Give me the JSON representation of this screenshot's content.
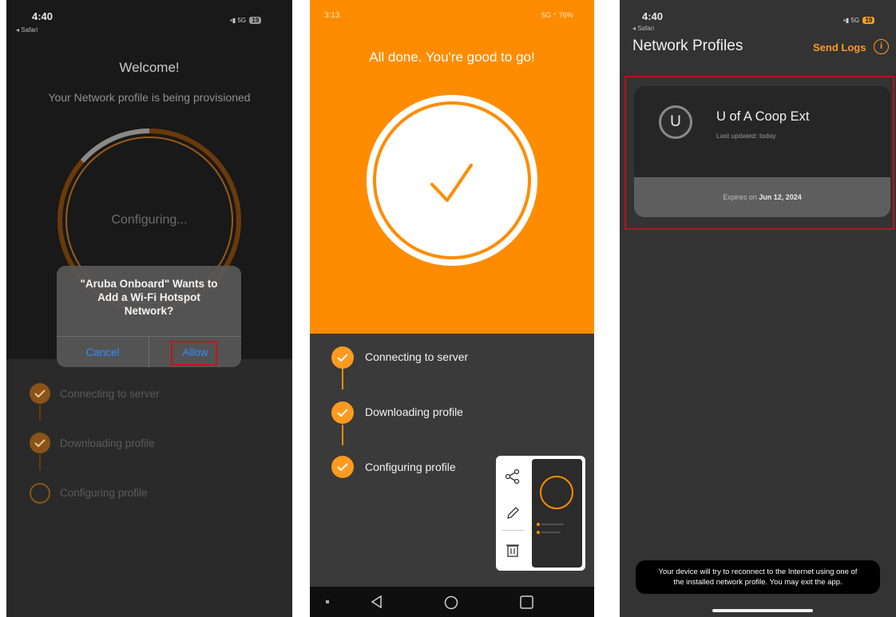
{
  "colors": {
    "accent_orange": "#ff8c00",
    "brand_orange_text": "#ff9a1f",
    "highlight_red": "#c4161c",
    "ios_blue": "#2f8cff"
  },
  "panel1": {
    "status": {
      "time": "4:40",
      "back_app": "◂ Safari",
      "network": "5G",
      "battery": "19"
    },
    "title": "Welcome!",
    "subtitle": "Your Network profile is being provisioned",
    "progress_label": "Configuring...",
    "dialog": {
      "line1": "\"Aruba Onboard\" Wants to",
      "line2": "Add a Wi-Fi Hotspot",
      "line3": "Network?",
      "cancel": "Cancel",
      "allow": "Allow"
    },
    "steps": [
      {
        "label": "Connecting to server",
        "done": true
      },
      {
        "label": "Downloading profile",
        "done": true
      },
      {
        "label": "Configuring profile",
        "done": false
      }
    ]
  },
  "panel2": {
    "status": {
      "time": "3:13",
      "right": "5G ⁺ 76%"
    },
    "title": "All done. You're good to go!",
    "steps": [
      {
        "label": "Connecting to server"
      },
      {
        "label": "Downloading profile"
      },
      {
        "label": "Configuring profile"
      }
    ],
    "popup_icons": [
      "share-icon",
      "edit-icon",
      "trash-icon"
    ]
  },
  "panel3": {
    "status": {
      "time": "4:40",
      "back_app": "◂ Safari",
      "network": "5G",
      "battery": "19"
    },
    "title": "Network Profiles",
    "send_logs": "Send Logs",
    "info": "i",
    "card": {
      "avatar_letter": "U",
      "name": "U of A Coop Ext",
      "updated": "Last updated: today",
      "expires_prefix": "Expires on",
      "expires_date": "Jun 12, 2024"
    },
    "toast_line1": "Your device will try to reconnect to the Internet using one of",
    "toast_line2": "the installed network profile. You may exit the app."
  }
}
